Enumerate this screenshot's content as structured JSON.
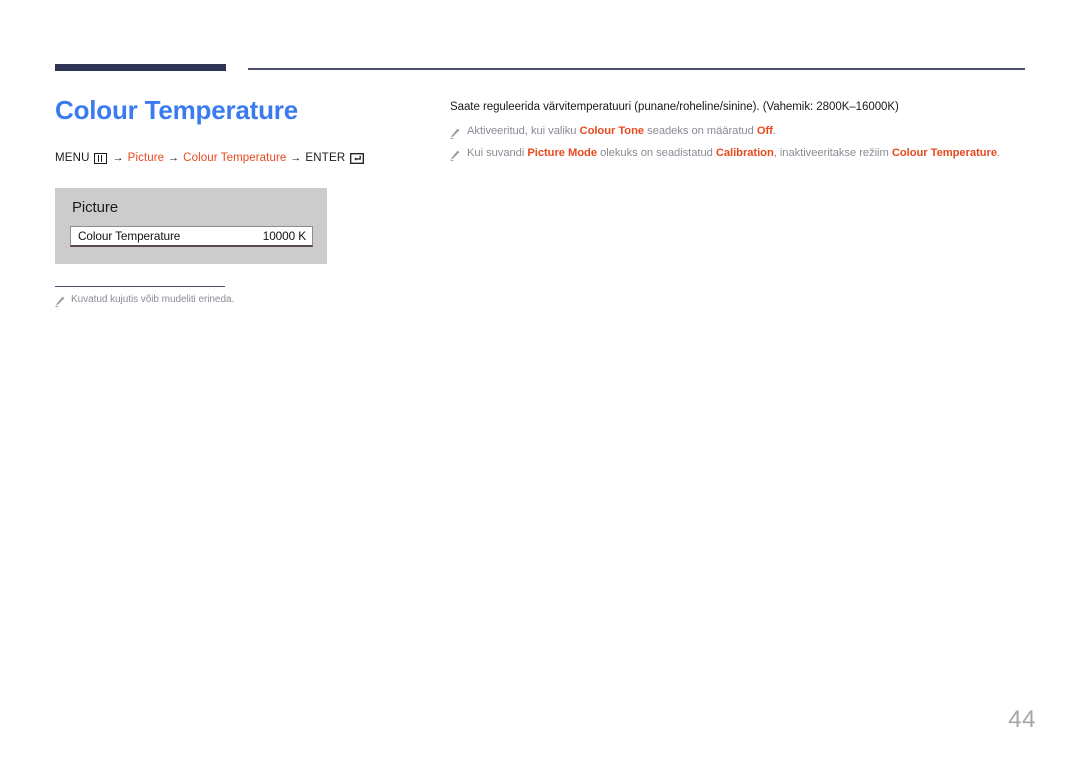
{
  "rules": {
    "thick_color": "#2e3456",
    "thin_color": "#4c4f6b"
  },
  "left": {
    "title": "Colour Temperature",
    "title_color": "#3b7bf0",
    "breadcrumb": {
      "menu_label": "MENU",
      "menu_icon": "menu-grid-icon",
      "arrow1": "→",
      "item1": "Picture",
      "arrow2": "→",
      "item2": "Colour Temperature",
      "arrow3": "→",
      "enter_label": "ENTER",
      "enter_icon": "enter-key-icon",
      "accent_color": "#e8491f"
    },
    "osd": {
      "heading": "Picture",
      "row_label": "Colour Temperature",
      "row_value": "10000 K"
    },
    "footnote": {
      "icon": "pencil-icon",
      "text": "Kuvatud kujutis võib mudeliti erineda."
    }
  },
  "right": {
    "intro": "Saate reguleerida värvitemperatuuri (punane/roheline/sinine). (Vahemik: 2800K–16000K)",
    "notes": [
      {
        "icon": "pencil-icon",
        "parts": [
          {
            "text": "Aktiveeritud, kui valiku ",
            "highlight": false
          },
          {
            "text": "Colour Tone",
            "highlight": true
          },
          {
            "text": " seadeks on määratud ",
            "highlight": false
          },
          {
            "text": "Off",
            "highlight": true
          },
          {
            "text": ".",
            "highlight": false
          }
        ]
      },
      {
        "icon": "pencil-icon",
        "parts": [
          {
            "text": "Kui suvandi ",
            "highlight": false
          },
          {
            "text": "Picture Mode",
            "highlight": true
          },
          {
            "text": " olekuks on seadistatud ",
            "highlight": false
          },
          {
            "text": "Calibration",
            "highlight": true
          },
          {
            "text": ", inaktiveeritakse režiim ",
            "highlight": false
          },
          {
            "text": "Colour Temperature",
            "highlight": true
          },
          {
            "text": ".",
            "highlight": false
          }
        ]
      }
    ]
  },
  "footer": {
    "page_number": "44"
  }
}
